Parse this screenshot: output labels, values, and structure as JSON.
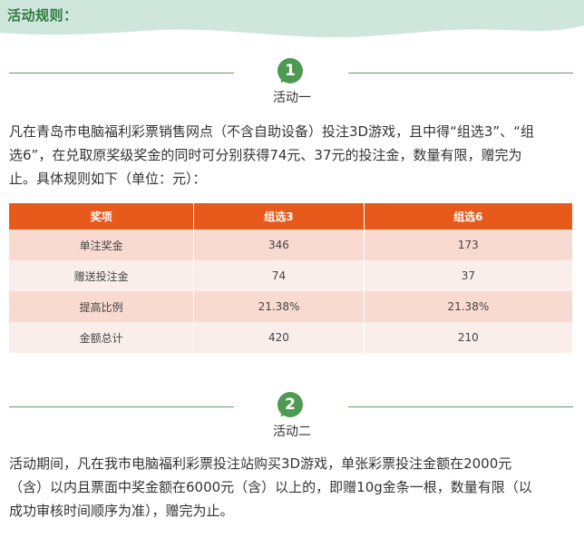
{
  "header": {
    "title": "活动规则："
  },
  "activity1": {
    "badge": "1",
    "title": "活动一",
    "paragraph_lines": [
      "凡在青岛市电脑福利彩票销售网点（不含自助设备）投注3D游戏，且中得“组选3”、“组",
      "选6”，在兑取原奖级奖金的同时可分别获得74元、37元的投注金，数量有限，赠完为",
      "止。具体规则如下（单位：元）："
    ]
  },
  "table": {
    "headers": [
      "奖项",
      "组选3",
      "组选6"
    ],
    "rows": [
      [
        "单注奖金",
        "346",
        "173"
      ],
      [
        "赠送投注金",
        "74",
        "37"
      ],
      [
        "提高比例",
        "21.38%",
        "21.38%"
      ],
      [
        "金额总计",
        "420",
        "210"
      ]
    ]
  },
  "activity2": {
    "badge": "2",
    "title": "活动二",
    "paragraph_lines": [
      "活动期间，凡在我市电脑福利彩票投注站购买3D游戏，单张彩票投注金额在2000元",
      "（含）以内且票面中奖金额在6000元（含）以上的，即赠10g金条一根，数量有限（以",
      "成功审核时间顺序为准），赠完为止。"
    ]
  },
  "colors": {
    "header_band": "#cfe6dd",
    "title_green": "#2d7a3e",
    "badge_green": "#4f9a52",
    "table_header": "#e85a1c",
    "row_odd": "#f8dad0",
    "row_even": "#f9eeea"
  }
}
